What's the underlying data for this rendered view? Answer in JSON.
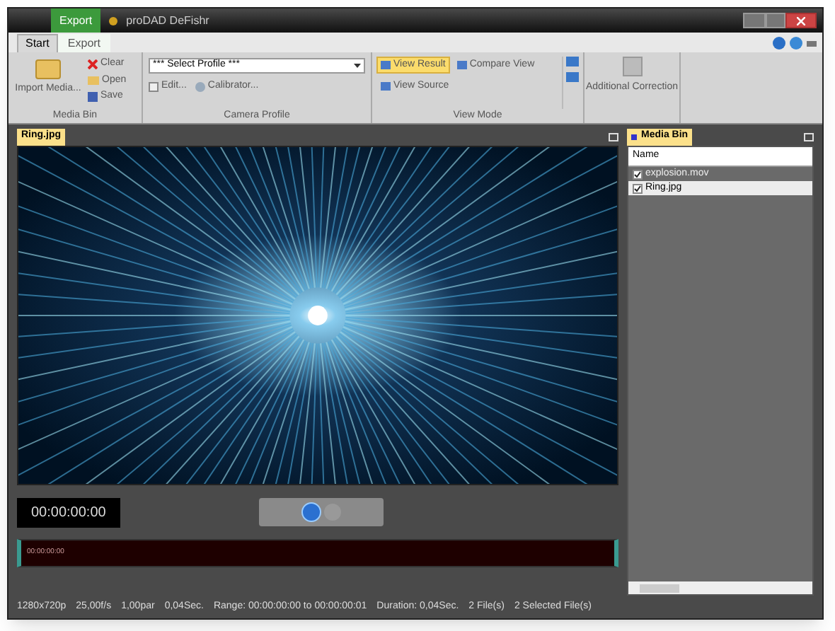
{
  "window": {
    "title": "proDAD DeFishr",
    "context_tab": "Export"
  },
  "ribbon_tabs": [
    {
      "label": "Start",
      "selected": true
    },
    {
      "label": "Export",
      "selected": false
    }
  ],
  "media_bin_group": {
    "import": "Import Media...",
    "clear": "Clear",
    "open": "Open",
    "save": "Save",
    "caption": "Media Bin"
  },
  "camera_profile_group": {
    "profile": "*** Select Profile ***",
    "edit": "Edit...",
    "calibrator": "Calibrator...",
    "caption": "Camera Profile"
  },
  "view_mode_group": {
    "buttons": [
      {
        "label": "View Result",
        "selected": true
      },
      {
        "label": "Compare View",
        "selected": false
      },
      {
        "label": "View Source",
        "selected": false
      }
    ],
    "caption": "View Mode"
  },
  "additional_correction": "Additional Correction",
  "preview": {
    "tab": "Ring.jpg",
    "timecode": "00:00:00:00",
    "timeline_timecode": "00:00:00:00"
  },
  "media_bin": {
    "tab": "Media Bin",
    "column": "Name",
    "files": [
      {
        "name": "explosion.mov",
        "checked": true,
        "selected": false
      },
      {
        "name": "Ring.jpg",
        "checked": true,
        "selected": true
      }
    ]
  },
  "status_bar": [
    "1280x720p",
    "25,00f/s",
    "1,00par",
    "0,04Sec.",
    "Range: 00:00:00:00 to 00:00:00:01",
    "Duration: 0,04Sec.",
    "2 File(s)",
    "2 Selected File(s)"
  ]
}
